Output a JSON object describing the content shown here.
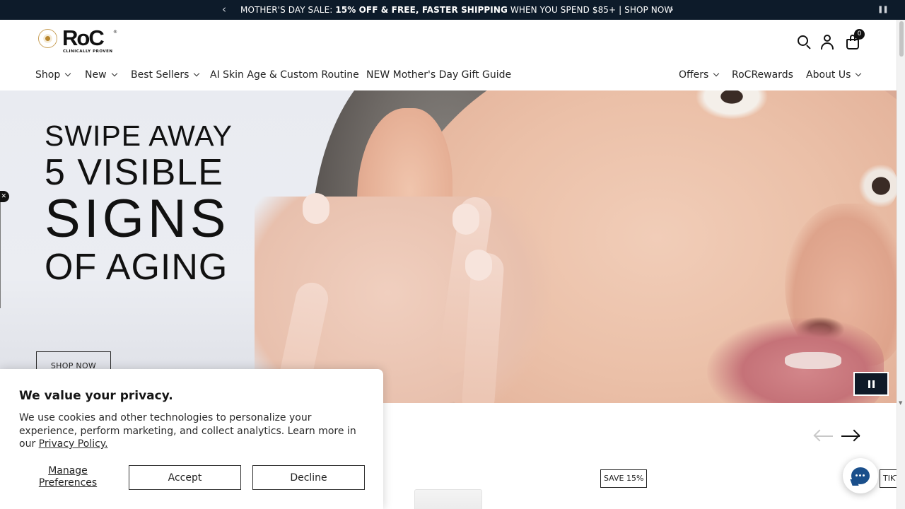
{
  "announcement": {
    "pre": "MOTHER'S DAY SALE: ",
    "bold": "15% OFF & FREE, FASTER SHIPPING",
    "post": " WHEN YOU SPEND $85+ | SHOP NOW",
    "prev_icon": "‹",
    "next_icon": "›",
    "pause_icon": "❚❚"
  },
  "logo": {
    "wordmark": "RoC",
    "tagline": "CLINICALLY PROVEN",
    "registered": "®"
  },
  "header": {
    "cart_count": "0",
    "icons": [
      "search-icon",
      "account-icon",
      "cart-icon"
    ]
  },
  "nav": {
    "left": [
      {
        "label": "Shop",
        "dropdown": true
      },
      {
        "label": "New",
        "dropdown": true
      },
      {
        "label": "Best Sellers",
        "dropdown": true
      },
      {
        "label": "AI Skin Age & Custom Routine",
        "dropdown": false
      },
      {
        "label": "NEW Mother's Day Gift Guide",
        "dropdown": false
      }
    ],
    "right": [
      {
        "label": "Offers",
        "dropdown": true
      },
      {
        "label": "RoCRewards",
        "dropdown": false
      },
      {
        "label": "About Us",
        "dropdown": true
      }
    ]
  },
  "hero": {
    "line1": "SWIPE AWAY",
    "line2": "5 VISIBLE",
    "line3": "SIGNS",
    "line4": "OF AGING",
    "cta": "SHOP NOW",
    "close_icon": "✕"
  },
  "products": {
    "badge_save": "SAVE 15%",
    "badge_partial": "TIKT"
  },
  "privacy": {
    "title": "We value your privacy.",
    "body": "We use cookies and other technologies to personalize your experience, perform marketing, and collect analytics. Learn more in our ",
    "link": "Privacy Policy.",
    "manage": "Manage Preferences",
    "accept": "Accept",
    "decline": "Decline"
  },
  "colors": {
    "announcement_bg": "#0d1b2a",
    "text": "#1a1a1a",
    "chat_accent": "#1a4f8b"
  }
}
